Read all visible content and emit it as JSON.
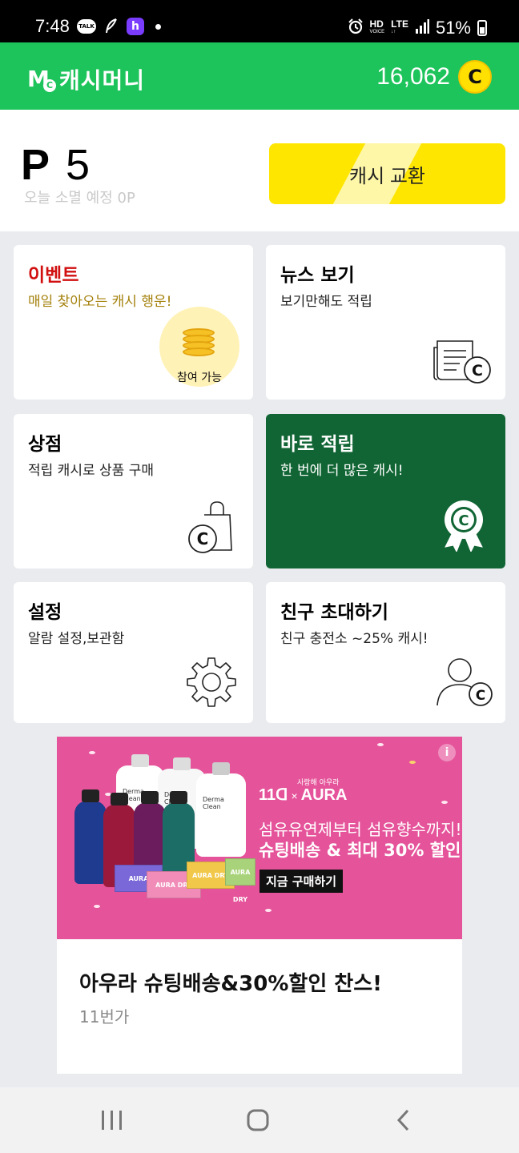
{
  "status_bar": {
    "time": "7:48",
    "talk_icon_text": "TALK",
    "h_icon_text": "h",
    "network": "HD",
    "network_sub": "VOICE",
    "lte": "LTE",
    "battery": "51%"
  },
  "header": {
    "logo_mark": "M",
    "logo_mark_sub": "C",
    "app_name": "캐시머니",
    "balance": "16,062",
    "coin_symbol": "C"
  },
  "points": {
    "prefix": "P",
    "value": "5",
    "expiry_note": "오늘 소멸 예정 0P",
    "exchange_button": "캐시 교환"
  },
  "cards": {
    "event": {
      "title": "이벤트",
      "desc": "매일 찾아오는 캐시 행운!",
      "badge": "참여 가능"
    },
    "news": {
      "title": "뉴스 보기",
      "desc": "보기만해도 적립"
    },
    "store": {
      "title": "상점",
      "desc": "적립 캐시로 상품 구매"
    },
    "instant": {
      "title": "바로 적립",
      "desc": "한 번에 더 많은 캐시!"
    },
    "settings": {
      "title": "설정",
      "desc": "알람 설정,보관함"
    },
    "invite": {
      "title": "친구 초대하기",
      "desc": "친구 충전소 ~25% 캐시!"
    }
  },
  "ad": {
    "info_icon": "i",
    "brand_left": "11ᗡ",
    "brand_x": "×",
    "brand_right": "AURA",
    "brand_tag": "사랑해 아우라",
    "headline1": "섬유유연제부터 섬유향수까지!",
    "headline2": "슈팅배송 & 최대 30% 할인",
    "cta": "지금 구매하기",
    "bottle_label": "Derma Clean",
    "box_label1": "AURA",
    "box_label2": "AURA DRY",
    "title": "아우라 슈팅배송&30%할인 찬스!",
    "source": "11번가"
  },
  "colors": {
    "header_green": "#1dc45b",
    "exchange_yellow": "#ffe600",
    "instant_card_green": "#116534",
    "event_title_red": "#d10f0f",
    "ad_pink": "#e5539a"
  },
  "icons": {
    "news": "newspaper-coin-icon",
    "store": "shopping-bag-coin-icon",
    "instant": "award-ribbon-coin-icon",
    "settings": "gear-icon",
    "invite": "person-coin-icon"
  }
}
